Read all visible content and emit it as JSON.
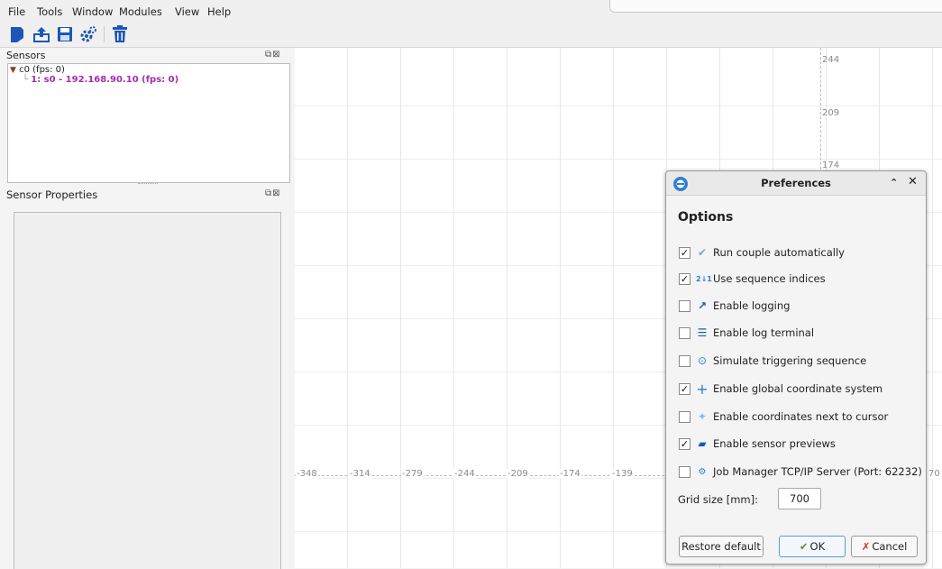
{
  "menu": [
    "File",
    "Tools",
    "Window",
    "Modules",
    "View",
    "Help"
  ],
  "toolbar_icons": [
    "new-icon",
    "export-icon",
    "save-icon",
    "settings-icon",
    "delete-icon"
  ],
  "sensors_pane": {
    "title": "Sensors",
    "tree_root": "c0 (fps: 0)",
    "tree_child": "1: s0 - 192.168.90.10 (fps: 0)"
  },
  "props_pane": {
    "title": "Sensor Properties"
  },
  "canvas": {
    "y_labels": [
      "244",
      "209",
      "174"
    ],
    "x_labels": [
      "-348",
      "-314",
      "-279",
      "-244",
      "-209",
      "-174",
      "-139"
    ],
    "x_label_right": "70"
  },
  "dialog": {
    "title": "Preferences",
    "heading": "Options",
    "options": [
      {
        "label": "Run couple automatically",
        "checked": true,
        "icon": "✔"
      },
      {
        "label": "Use sequence indices",
        "checked": true,
        "icon": "2↓1"
      },
      {
        "label": "Enable logging",
        "checked": false,
        "icon": "↗"
      },
      {
        "label": "Enable log terminal",
        "checked": false,
        "icon": "☰"
      },
      {
        "label": "Simulate triggering sequence",
        "checked": false,
        "icon": "⊙"
      },
      {
        "label": "Enable global coordinate system",
        "checked": true,
        "icon": "+"
      },
      {
        "label": "Enable coordinates next to cursor",
        "checked": false,
        "icon": "✦"
      },
      {
        "label": "Enable sensor previews",
        "checked": true,
        "icon": "▰"
      },
      {
        "label": "Job Manager TCP/IP Server (Port: 62232)",
        "checked": false,
        "icon": "⚙"
      }
    ],
    "grid_label": "Grid size [mm]:",
    "grid_value": "700",
    "restore_label": "Restore default",
    "ok_label": "OK",
    "cancel_label": "Cancel"
  }
}
